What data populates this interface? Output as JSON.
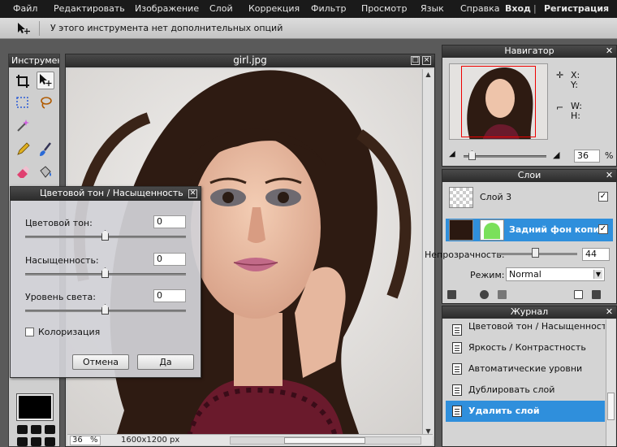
{
  "menu": {
    "items": [
      "Файл",
      "Редактировать",
      "Изображение",
      "Слой",
      "Коррекция",
      "Фильтр",
      "Просмотр",
      "Язык",
      "Справка"
    ],
    "login": "Вход",
    "separator": "|",
    "register": "Регистрация"
  },
  "options_bar": {
    "message": "У этого инструмента нет дополнительных опций"
  },
  "tools_panel": {
    "title": "Инструменты",
    "tools": [
      "crop-icon",
      "move-icon",
      "marquee-icon",
      "lasso-icon",
      "magic-wand-icon",
      "pencil-icon",
      "brush-icon",
      "eraser-icon",
      "bucket-icon"
    ],
    "foreground_color": "#000000"
  },
  "image_window": {
    "title": "girl.jpg",
    "zoom": "36",
    "zoom_unit": "%",
    "dimensions": "1600x1200 px"
  },
  "navigator": {
    "title": "Навигатор",
    "x_label": "X:",
    "y_label": "Y:",
    "w_label": "W:",
    "h_label": "H:",
    "zoom": "36",
    "zoom_unit": "%"
  },
  "layers": {
    "title": "Слои",
    "items": [
      {
        "name": "Слой 3",
        "visible": true,
        "selected": false
      },
      {
        "name": "Задний фон копи",
        "visible": true,
        "selected": true
      }
    ],
    "opacity_label": "Непрозрачность:",
    "opacity_value": "44",
    "mode_label": "Режим:",
    "mode_value": "Normal"
  },
  "journal": {
    "title": "Журнал",
    "items": [
      {
        "label": "Цветовой тон / Насыщенность",
        "selected": false
      },
      {
        "label": "Яркость / Контрастность",
        "selected": false
      },
      {
        "label": "Автоматические уровни",
        "selected": false
      },
      {
        "label": "Дублировать слой",
        "selected": false
      },
      {
        "label": "Удалить слой",
        "selected": true
      }
    ]
  },
  "dialog": {
    "title": "Цветовой тон / Насыщенность",
    "hue_label": "Цветовой тон:",
    "hue_value": "0",
    "saturation_label": "Насыщенность:",
    "saturation_value": "0",
    "lightness_label": "Уровень света:",
    "lightness_value": "0",
    "colorize_label": "Колоризация",
    "cancel_label": "Отмена",
    "ok_label": "Да"
  },
  "colors": {
    "accent": "#2f8fdc",
    "titlebar": "#2b2b2b",
    "menubar": "#1a1a1a"
  }
}
